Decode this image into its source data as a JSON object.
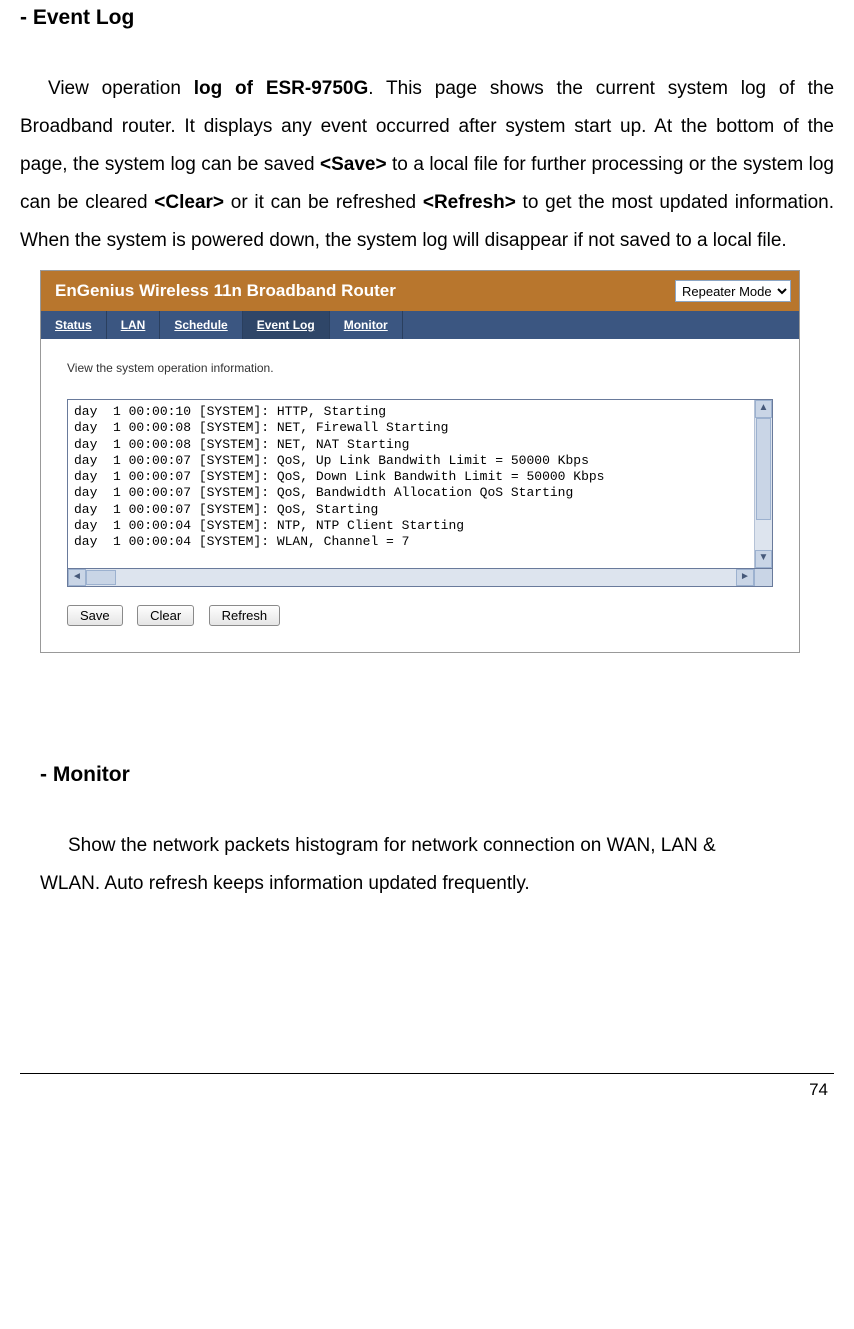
{
  "headings": {
    "event_log": "- Event Log",
    "monitor": "- Monitor"
  },
  "event_paragraph": {
    "p1a": "View operation ",
    "p1b_bold": "log of ESR-9750G",
    "p1c": ". This page shows the current system log of the Broadband router. It displays any event occurred after system start up. At the bottom of the page, the system log can be saved ",
    "p1d_bold": "<Save>",
    "p1e": " to a local file for further processing or the system log can be cleared ",
    "p1f_bold": "<Clear>",
    "p1g": " or it can be refreshed ",
    "p1h_bold": "<Refresh>",
    "p1i": " to get the most updated information. When the system is powered down, the system log will disappear if not saved to a local file."
  },
  "router_ui": {
    "title": "EnGenius Wireless 11n Broadband Router",
    "mode_selected": "Repeater Mode",
    "tabs": [
      "Status",
      "LAN",
      "Schedule",
      "Event Log",
      "Monitor"
    ],
    "active_tab_index": 3,
    "info_text": "View the system operation information.",
    "log_lines": [
      "day  1 00:00:10 [SYSTEM]: HTTP, Starting",
      "day  1 00:00:08 [SYSTEM]: NET, Firewall Starting",
      "day  1 00:00:08 [SYSTEM]: NET, NAT Starting",
      "day  1 00:00:07 [SYSTEM]: QoS, Up Link Bandwith Limit = 50000 Kbps",
      "day  1 00:00:07 [SYSTEM]: QoS, Down Link Bandwith Limit = 50000 Kbps",
      "day  1 00:00:07 [SYSTEM]: QoS, Bandwidth Allocation QoS Starting",
      "day  1 00:00:07 [SYSTEM]: QoS, Starting",
      "day  1 00:00:04 [SYSTEM]: NTP, NTP Client Starting",
      "day  1 00:00:04 [SYSTEM]: WLAN, Channel = 7"
    ],
    "buttons": {
      "save": "Save",
      "clear": "Clear",
      "refresh": "Refresh"
    }
  },
  "monitor_paragraph": {
    "line1": "Show the network packets histogram for network connection on WAN, LAN &",
    "line2": "WLAN. Auto refresh keeps information updated frequently."
  },
  "page_number": "74"
}
